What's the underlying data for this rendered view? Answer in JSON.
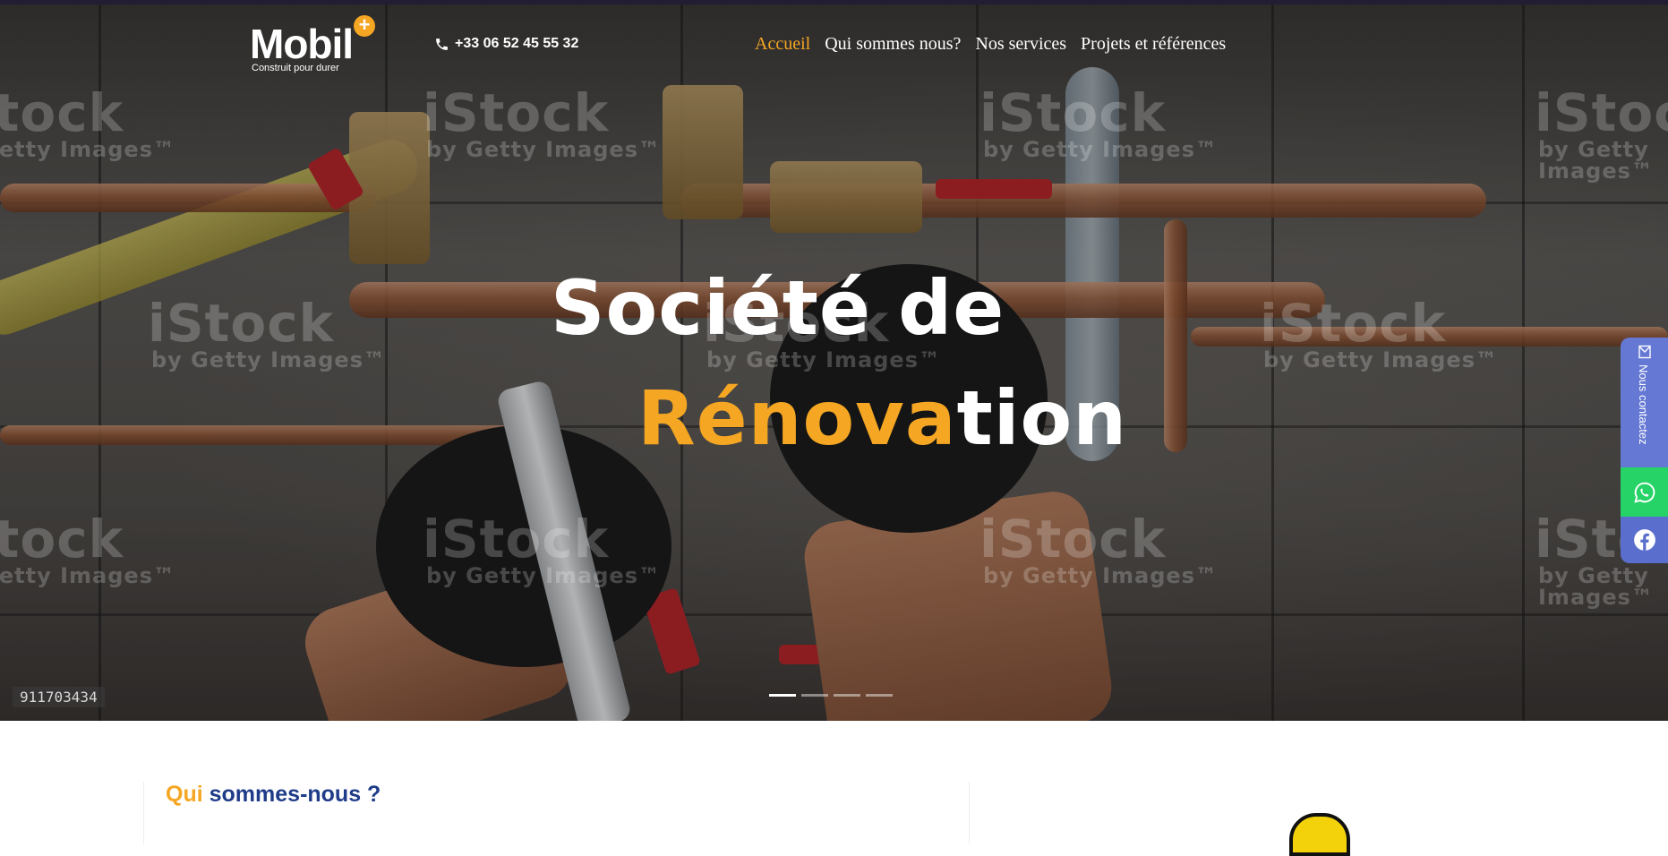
{
  "header": {
    "logo": {
      "word": "Mobil",
      "plus": "+",
      "tagline": "Construit pour durer"
    },
    "phone": {
      "icon": "phone-icon",
      "number": "+33 06 52 45 55 32"
    },
    "nav": [
      {
        "label": "Accueil",
        "active": true
      },
      {
        "label": "Qui sommes nous?",
        "active": false
      },
      {
        "label": "Nos services",
        "active": false
      },
      {
        "label": "Projets et références",
        "active": false
      }
    ]
  },
  "hero": {
    "title_line1": "Société de",
    "title_line2_accent": "Rénova",
    "title_line2_rest": "tion",
    "accent_color": "#f5a623",
    "watermark": {
      "brand": "iStock",
      "sub": "by Getty Images™"
    },
    "stock_id": "911703434",
    "slider": {
      "total": 4,
      "active": 1
    }
  },
  "side_widgets": {
    "contact_label": "Nous contactez",
    "contact_icon": "envelope-icon",
    "whatsapp_icon": "whatsapp-icon",
    "facebook_icon": "facebook-icon",
    "contact_color": "#6478d4",
    "whatsapp_color": "#25d366",
    "facebook_color": "#5a6fcd"
  },
  "about": {
    "title_accent": "Qui",
    "title_rest": "sommes-nous ?"
  }
}
